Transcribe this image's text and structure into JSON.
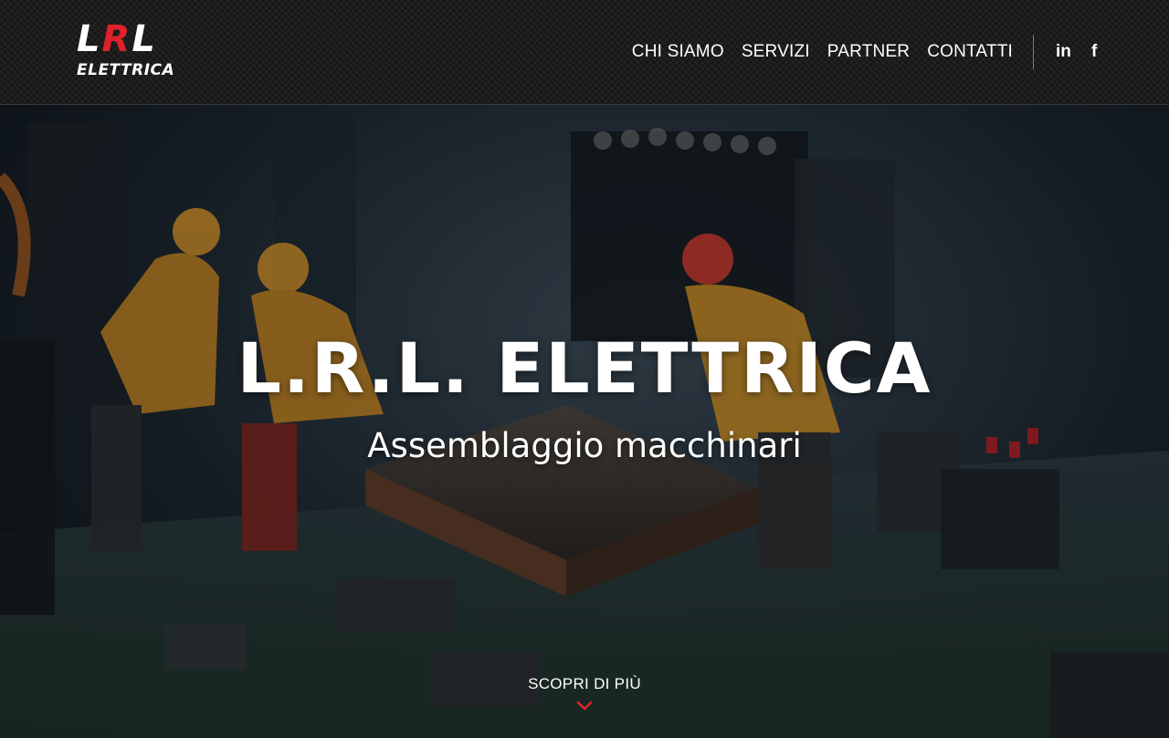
{
  "brand": {
    "logo_top_left": "L",
    "logo_top_accent": "R",
    "logo_top_right": "L",
    "logo_bottom": "ELETTRICA",
    "accent_color": "#e0202a"
  },
  "nav": {
    "items": [
      {
        "label": "CHI SIAMO"
      },
      {
        "label": "SERVIZI"
      },
      {
        "label": "PARTNER"
      },
      {
        "label": "CONTATTI"
      }
    ]
  },
  "social": {
    "linkedin": {
      "label": "in",
      "icon": "linkedin-icon"
    },
    "facebook": {
      "label": "f",
      "icon": "facebook-icon"
    }
  },
  "hero": {
    "title": "L.R.L. ELETTRICA",
    "subtitle": "Assemblaggio macchinari",
    "cta_label": "SCOPRI DI PIÙ",
    "cta_icon": "chevron-down-icon",
    "cta_icon_color": "#e0202a",
    "background_image": "miniature-workers-on-circuit-board-photo"
  }
}
